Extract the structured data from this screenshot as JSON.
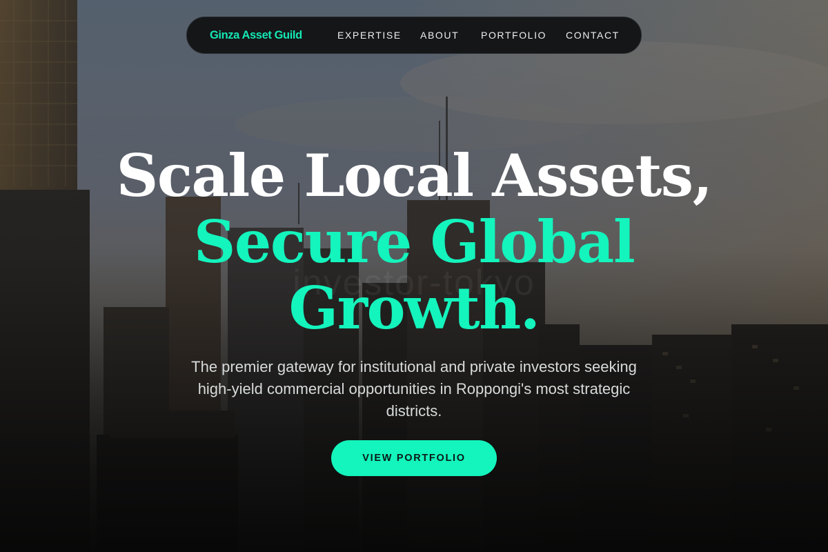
{
  "nav": {
    "brand": "Ginza Asset Guild",
    "links": [
      {
        "label": "EXPERTISE"
      },
      {
        "label": "ABOUT"
      },
      {
        "label": "PORTFOLIO"
      },
      {
        "label": "CONTACT"
      }
    ]
  },
  "hero": {
    "headline_line1": "Scale Local Assets,",
    "headline_line2": "Secure Global",
    "headline_line3": "Growth.",
    "subtitle": "The premier gateway for institutional and private investors seeking high-yield commercial opportunities in Roppongi's most strategic districts.",
    "cta_label": "VIEW PORTFOLIO",
    "background_image": "city-skyline-photo",
    "watermark": "investor-tokyo"
  },
  "colors": {
    "accent": "#14f4bd",
    "brand": "#14e8b4",
    "nav_bg": "#141618",
    "text_light": "#ffffff"
  }
}
